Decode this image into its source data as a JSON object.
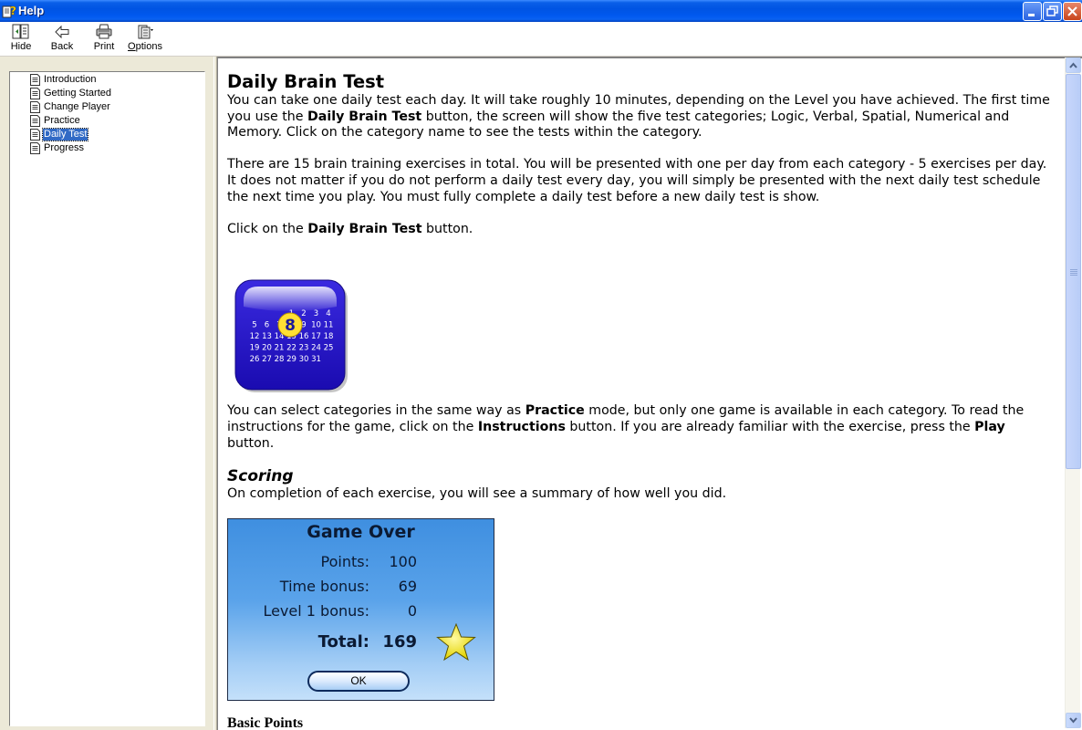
{
  "window": {
    "title": "Help",
    "controls": {
      "minimize": "minimize",
      "restore": "restore",
      "close": "close"
    }
  },
  "toolbar": {
    "hide_label": "Hide",
    "back_label": "Back",
    "print_label": "Print",
    "options_label": "Options"
  },
  "nav": {
    "items": [
      {
        "label": "Introduction",
        "selected": false
      },
      {
        "label": "Getting Started",
        "selected": false
      },
      {
        "label": "Change Player",
        "selected": false
      },
      {
        "label": "Practice",
        "selected": false
      },
      {
        "label": "Daily Test",
        "selected": true
      },
      {
        "label": "Progress",
        "selected": false
      }
    ]
  },
  "content": {
    "title": "Daily Brain Test",
    "p1": {
      "a": "You can take one daily test each day.  It will take roughly 10 minutes, depending on the Level you have achieved. The first time you use the ",
      "b": "Daily Brain Test",
      "c": " button, the screen will show the five test categories; Logic, Verbal, Spatial, Numerical and Memory.  Click on the category name to see the tests within the category."
    },
    "p2": "There are 15 brain training exercises in total.  You will be presented with one per day from each category - 5 exercises per day.  It does not matter if you do not perform a daily test every day, you will simply be presented with the next daily test schedule the next time you play.  You must fully complete a daily test before a new daily test is show.",
    "p3": {
      "a": "Click on the ",
      "b": "Daily Brain Test",
      "c": " button."
    },
    "calendar_icon": {
      "highlight_day": "8",
      "rows": [
        [
          "",
          "",
          "",
          "1",
          "2",
          "3",
          "4"
        ],
        [
          "5",
          "6",
          "7",
          "8",
          "9",
          "10",
          "11"
        ],
        [
          "12",
          "13",
          "14",
          "15",
          "16",
          "17",
          "18"
        ],
        [
          "19",
          "20",
          "21",
          "22",
          "23",
          "24",
          "25"
        ],
        [
          "26",
          "27",
          "28",
          "29",
          "30",
          "31",
          ""
        ]
      ]
    },
    "p4": {
      "a": "You can select categories in the same way as ",
      "b": "Practice",
      "c": " mode, but only one game is available in each category. To read the instructions for the game, click on the ",
      "d": "Instructions",
      "e": " button.  If you are already familiar with the exercise, press the ",
      "f": "Play",
      "g": " button."
    },
    "scoring_heading": "Scoring",
    "p5": "On completion of each exercise, you will see a summary of how well you did.",
    "game_over": {
      "title": "Game Over",
      "rows": [
        {
          "label": "Points:",
          "value": "100"
        },
        {
          "label": "Time bonus:",
          "value": "69"
        },
        {
          "label": "Level 1 bonus:",
          "value": "0"
        }
      ],
      "total_label": "Total:",
      "total_value": "169",
      "ok_label": "OK"
    },
    "basic_points_heading": "Basic Points"
  },
  "scrollbar": {
    "position_fraction": 0.0,
    "visible_fraction": 0.62
  }
}
